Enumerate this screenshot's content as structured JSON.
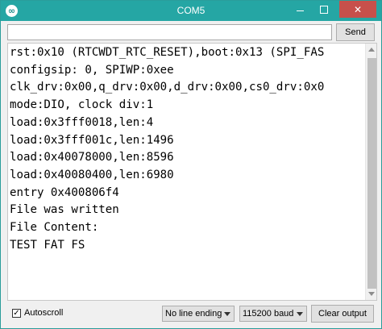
{
  "window": {
    "title": "COM5",
    "accent_color": "#25a6a4",
    "close_color": "#c7504b"
  },
  "send": {
    "input_value": "",
    "button_label": "Send"
  },
  "serial_output": {
    "lines": [
      "rst:0x10 (RTCWDT_RTC_RESET),boot:0x13 (SPI_FAS",
      "configsip: 0, SPIWP:0xee",
      "clk_drv:0x00,q_drv:0x00,d_drv:0x00,cs0_drv:0x0",
      "mode:DIO, clock div:1",
      "load:0x3fff0018,len:4",
      "load:0x3fff001c,len:1496",
      "load:0x40078000,len:8596",
      "load:0x40080400,len:6980",
      "entry 0x400806f4",
      "File was written",
      "File Content:",
      "TEST FAT FS",
      "",
      ""
    ]
  },
  "footer": {
    "autoscroll_label": "Autoscroll",
    "autoscroll_checked": true,
    "check_mark": "✓",
    "line_ending": "No line ending",
    "baud": "115200 baud",
    "clear_label": "Clear output"
  }
}
